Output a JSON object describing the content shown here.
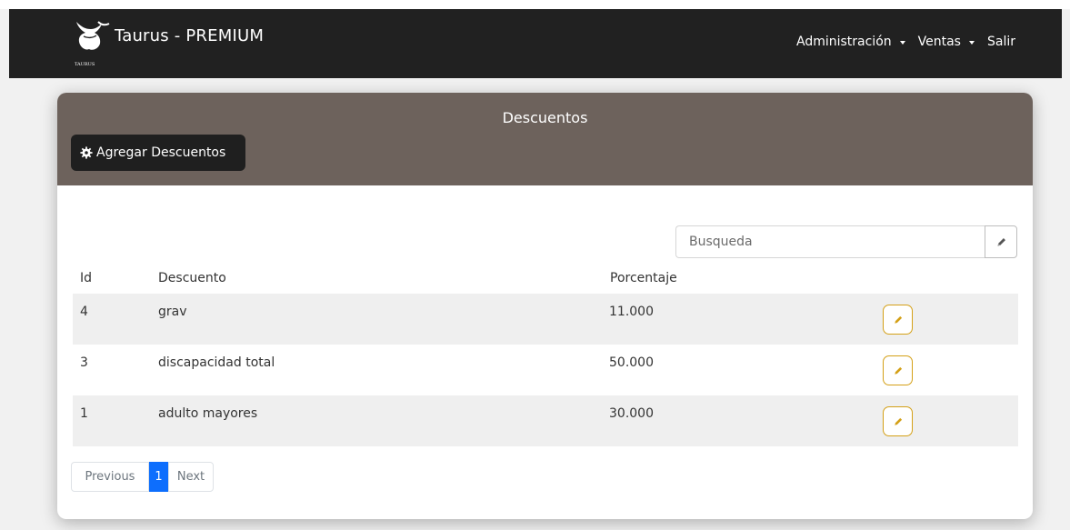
{
  "app": {
    "title": "Taurus - PREMIUM",
    "logo_text": "TAURUS"
  },
  "nav": [
    {
      "label": "Administración",
      "dropdown": true
    },
    {
      "label": "Ventas",
      "dropdown": true
    },
    {
      "label": "Salir",
      "dropdown": false
    }
  ],
  "card": {
    "title": "Descuentos",
    "add_button": {
      "label": "Agregar Descuentos",
      "icon": "gear-icon"
    }
  },
  "search": {
    "placeholder": "Busqueda",
    "button_icon": "pencil-icon"
  },
  "table": {
    "columns": [
      "Id",
      "Descuento",
      "Porcentaje"
    ],
    "rows": [
      {
        "id": "4",
        "descuento": "grav",
        "porcentaje": "11.000"
      },
      {
        "id": "3",
        "descuento": "discapacidad total",
        "porcentaje": "50.000"
      },
      {
        "id": "1",
        "descuento": "adulto mayores",
        "porcentaje": "30.000"
      }
    ]
  },
  "pagination": {
    "previous": "Previous",
    "current": "1",
    "next": "Next"
  },
  "colors": {
    "navbar": "#212121",
    "card_header": "#6d625c",
    "edit_accent": "#d4a017",
    "page_active": "#0d6efd"
  }
}
